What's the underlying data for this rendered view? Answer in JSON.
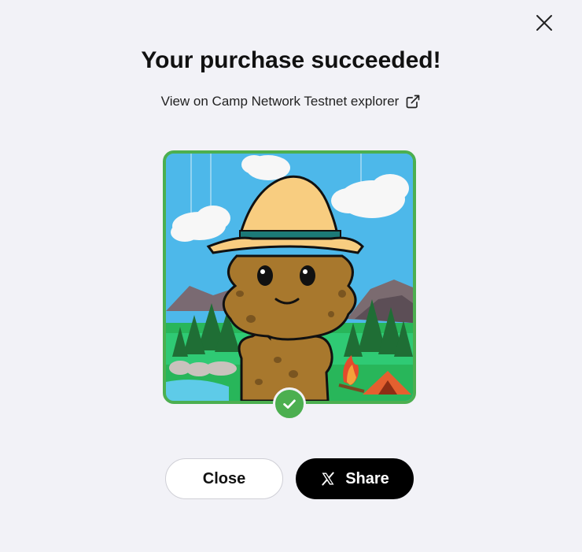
{
  "dialog": {
    "title": "Your purchase succeeded!",
    "explorer_link": "View on Camp Network Testnet explorer",
    "close_button_label": "Close",
    "share_button_label": "Share"
  },
  "icons": {
    "close": "close-icon",
    "external_link": "external-link-icon",
    "success": "check-icon",
    "share": "x-logo-icon"
  },
  "colors": {
    "background": "#f2f2f7",
    "success_green": "#4caf50",
    "share_button": "#000000"
  }
}
